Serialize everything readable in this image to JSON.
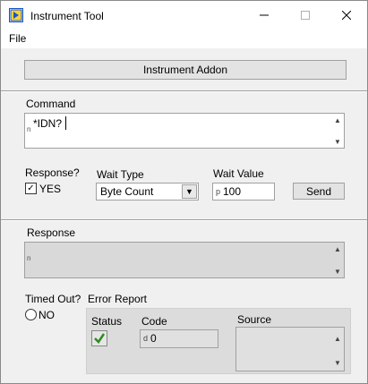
{
  "window": {
    "title": "Instrument Tool",
    "controls": {
      "minimize": "—",
      "maximize": "☐",
      "close": "✕"
    }
  },
  "menu": {
    "file": "File"
  },
  "addon_button": "Instrument Addon",
  "command": {
    "label": "Command",
    "value": "*IDN?",
    "index_glyph": "n"
  },
  "response_toggle": {
    "label": "Response?",
    "checkbox_label": "YES",
    "checked": true
  },
  "wait_type": {
    "label": "Wait Type",
    "value": "Byte Count"
  },
  "wait_value": {
    "label": "Wait Value",
    "prefix": "p",
    "value": "100"
  },
  "send_button": "Send",
  "response": {
    "label": "Response",
    "value": "",
    "index_glyph": "n"
  },
  "timed_out": {
    "label": "Timed Out?",
    "value_label": "NO"
  },
  "error_report": {
    "label": "Error Report",
    "status_label": "Status",
    "code_label": "Code",
    "code_prefix": "d",
    "code_value": "0",
    "source_label": "Source",
    "source_value": ""
  },
  "icons": {
    "app": "labview-vi-icon",
    "status": "green-check-icon"
  }
}
